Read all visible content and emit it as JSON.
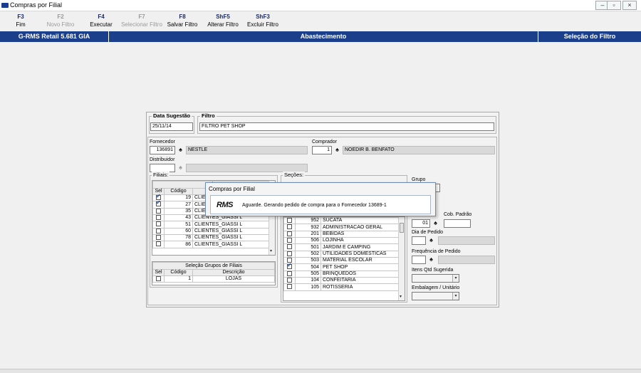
{
  "window": {
    "title": "Compras por Filial"
  },
  "toolbar": [
    {
      "key": "F3",
      "label": "Fim",
      "enabled": true
    },
    {
      "key": "F2",
      "label": "Novo Filtro",
      "enabled": false
    },
    {
      "key": "F4",
      "label": "Executar",
      "enabled": true
    },
    {
      "key": "F7",
      "label": "Selecionar Filtro",
      "enabled": false
    },
    {
      "key": "F8",
      "label": "Salvar Filtro",
      "enabled": true
    },
    {
      "key": "ShF5",
      "label": "Alterar Filtro",
      "enabled": true
    },
    {
      "key": "ShF3",
      "label": "Excluir Filtro",
      "enabled": true
    }
  ],
  "header": {
    "app": "G-RMS Retail 5.681 GIA",
    "module": "Abastecimento",
    "screen": "Seleção do Filtro"
  },
  "form": {
    "data_sugestao": {
      "label": "Data Sugestão",
      "value": "25/11/14"
    },
    "filtro": {
      "label": "Filtro",
      "value": "FILTRO PET SHOP"
    },
    "fornecedor": {
      "label": "Fornecedor",
      "code": "136891",
      "name": "NESTLE"
    },
    "comprador": {
      "label": "Comprador",
      "code": "1",
      "name": "NOEDIR B. BENFATO"
    },
    "distribuidor": {
      "label": "Distribuidor",
      "code": "",
      "name": ""
    },
    "grupo": {
      "label": "Grupo"
    },
    "cob_padrao": {
      "label": "Cob. Padrão",
      "code": "01",
      "value": ""
    },
    "dia_pedido": {
      "label": "Dia de Pedido"
    },
    "frequencia": {
      "label": "Frequência de Pedido"
    },
    "itens_qtd": {
      "label": "Itens Qtd Sugerida"
    },
    "embalagem": {
      "label": "Embalagem / Unitário"
    }
  },
  "filiais": {
    "group_label": "Filiais:",
    "table_title": "Sele",
    "columns": [
      "Sel",
      "Código"
    ],
    "rows": [
      {
        "sel": true,
        "code": "19",
        "desc": "CLIEN"
      },
      {
        "sel": true,
        "code": "27",
        "desc": "CLIEN"
      },
      {
        "sel": false,
        "code": "35",
        "desc": "CLIEN"
      },
      {
        "sel": false,
        "code": "43",
        "desc": "CLIENTES_GIASSI L"
      },
      {
        "sel": false,
        "code": "51",
        "desc": "CLIENTES_GIASSI L"
      },
      {
        "sel": false,
        "code": "60",
        "desc": "CLIENTES_GIASSI L"
      },
      {
        "sel": false,
        "code": "78",
        "desc": "CLIENTES_GIASSI L"
      },
      {
        "sel": false,
        "code": "86",
        "desc": "CLIENTES_GIASSI L"
      }
    ]
  },
  "grupos_filiais": {
    "title": "Seleção Grupos de Filiais",
    "columns": [
      "Sel",
      "Código",
      "Descrição"
    ],
    "rows": [
      {
        "sel": false,
        "code": "1",
        "desc": "LOJAS"
      }
    ]
  },
  "secoes": {
    "group_label": "Seções:",
    "rows": [
      {
        "sel": false,
        "code": "952",
        "desc": "SUCATA"
      },
      {
        "sel": false,
        "code": "932",
        "desc": "ADMINISTRACAO GERAL"
      },
      {
        "sel": false,
        "code": "201",
        "desc": "BEBIDAS"
      },
      {
        "sel": false,
        "code": "506",
        "desc": "LOJINHA"
      },
      {
        "sel": false,
        "code": "501",
        "desc": "JARDIM E CAMPING"
      },
      {
        "sel": false,
        "code": "502",
        "desc": "UTILIDADES DOMESTICAS"
      },
      {
        "sel": false,
        "code": "503",
        "desc": "MATERIAL ESCOLAR"
      },
      {
        "sel": true,
        "code": "504",
        "desc": "PET SHOP"
      },
      {
        "sel": false,
        "code": "505",
        "desc": "BRINQUEDOS"
      },
      {
        "sel": false,
        "code": "104",
        "desc": "CONFEITARIA"
      },
      {
        "sel": false,
        "code": "105",
        "desc": "ROTISSERIA"
      }
    ]
  },
  "dialog": {
    "title": "Compras por Filial",
    "logo": "RMS",
    "message": "Aguarde. Gerando pedido de compra para o Fornecedor 13689-1"
  }
}
